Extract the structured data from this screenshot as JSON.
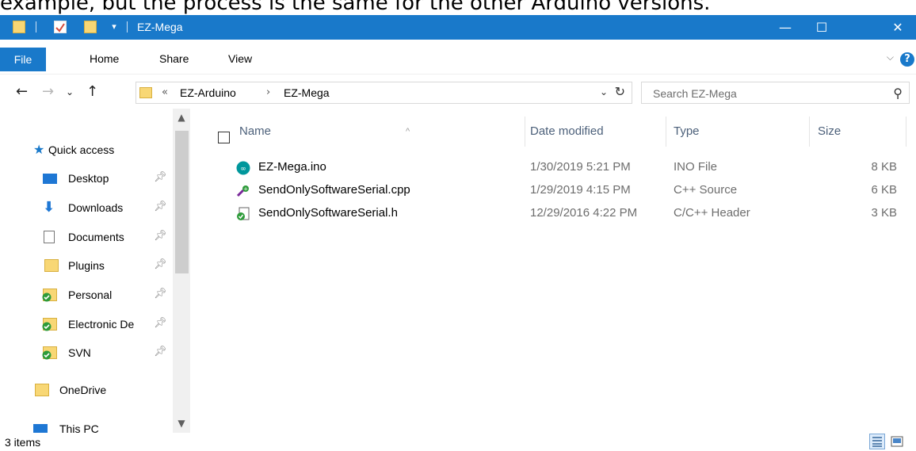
{
  "page_text": "example, but the process is the same for the other Arduino versions.",
  "window": {
    "title": "EZ-Mega",
    "controls": {
      "minimize": "—",
      "maximize": "☐",
      "close": "✕"
    },
    "accent": "#1979ca"
  },
  "ribbon": {
    "tabs": [
      "File",
      "Home",
      "Share",
      "View"
    ],
    "help": "?"
  },
  "nav": {
    "breadcrumb_prefix": "«",
    "breadcrumb": [
      "EZ-Arduino",
      "EZ-Mega"
    ],
    "breadcrumb_sep": "›",
    "search_placeholder": "Search EZ-Mega"
  },
  "sidebar": {
    "items": [
      {
        "label": "Quick access",
        "icon": "star-icon"
      },
      {
        "label": "Desktop",
        "icon": "desktop-icon",
        "pinned": true
      },
      {
        "label": "Downloads",
        "icon": "download-arrow-icon",
        "pinned": true
      },
      {
        "label": "Documents",
        "icon": "documents-icon",
        "pinned": true
      },
      {
        "label": "Plugins",
        "icon": "folder-icon",
        "pinned": true
      },
      {
        "label": "Personal",
        "icon": "svn-folder-icon",
        "pinned": true
      },
      {
        "label": "Electronic De",
        "icon": "svn-folder-icon",
        "pinned": true
      },
      {
        "label": "SVN",
        "icon": "svn-folder-icon",
        "pinned": true
      },
      {
        "label": "OneDrive",
        "icon": "onedrive-folder-icon"
      },
      {
        "label": "This PC",
        "icon": "computer-icon"
      }
    ]
  },
  "columns": {
    "name": "Name",
    "date": "Date modified",
    "type": "Type",
    "size": "Size"
  },
  "files": [
    {
      "name": "EZ-Mega.ino",
      "date": "1/30/2019 5:21 PM",
      "type": "INO File",
      "size": "8 KB",
      "icon": "arduino-file-icon"
    },
    {
      "name": "SendOnlySoftwareSerial.cpp",
      "date": "1/29/2019 4:15 PM",
      "type": "C++ Source",
      "size": "6 KB",
      "icon": "cpp-file-icon"
    },
    {
      "name": "SendOnlySoftwareSerial.h",
      "date": "12/29/2016 4:22 PM",
      "type": "C/C++ Header",
      "size": "3 KB",
      "icon": "header-file-icon"
    }
  ],
  "status": {
    "count": "3 items"
  }
}
